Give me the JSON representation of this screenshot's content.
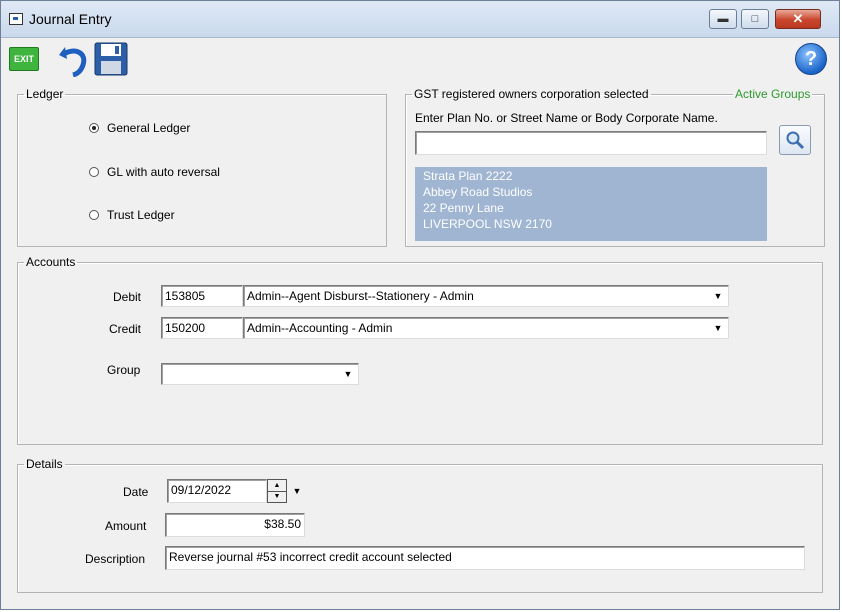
{
  "window": {
    "title": "Journal Entry"
  },
  "toolbar": {
    "exit_label": "EXIT",
    "help_label": "?"
  },
  "ledger": {
    "legend": "Ledger",
    "options": [
      {
        "label": "General Ledger",
        "selected": true
      },
      {
        "label": "GL with auto reversal",
        "selected": false
      },
      {
        "label": "Trust Ledger",
        "selected": false
      }
    ]
  },
  "owners": {
    "legend": "GST registered owners corporation selected",
    "active_groups": "Active Groups",
    "prompt": "Enter Plan No. or Street Name or Body Corporate Name.",
    "search_value": "",
    "address_lines": [
      "Strata Plan 2222",
      "Abbey Road Studios",
      "22 Penny Lane",
      "LIVERPOOL  NSW  2170"
    ]
  },
  "accounts": {
    "legend": "Accounts",
    "debit_label": "Debit",
    "debit_code": "153805",
    "debit_name": "Admin--Agent Disburst--Stationery - Admin",
    "credit_label": "Credit",
    "credit_code": "150200",
    "credit_name": "Admin--Accounting - Admin",
    "group_label": "Group",
    "group_value": ""
  },
  "details": {
    "legend": "Details",
    "date_label": "Date",
    "date_value": "09/12/2022",
    "amount_label": "Amount",
    "amount_value": "$38.50",
    "description_label": "Description",
    "description_value": "Reverse journal #53 incorrect credit account selected"
  },
  "colors": {
    "active_groups": "#2e9a2e",
    "address_bg": "#9fb5d1",
    "exit_bg": "#3fb53f"
  }
}
